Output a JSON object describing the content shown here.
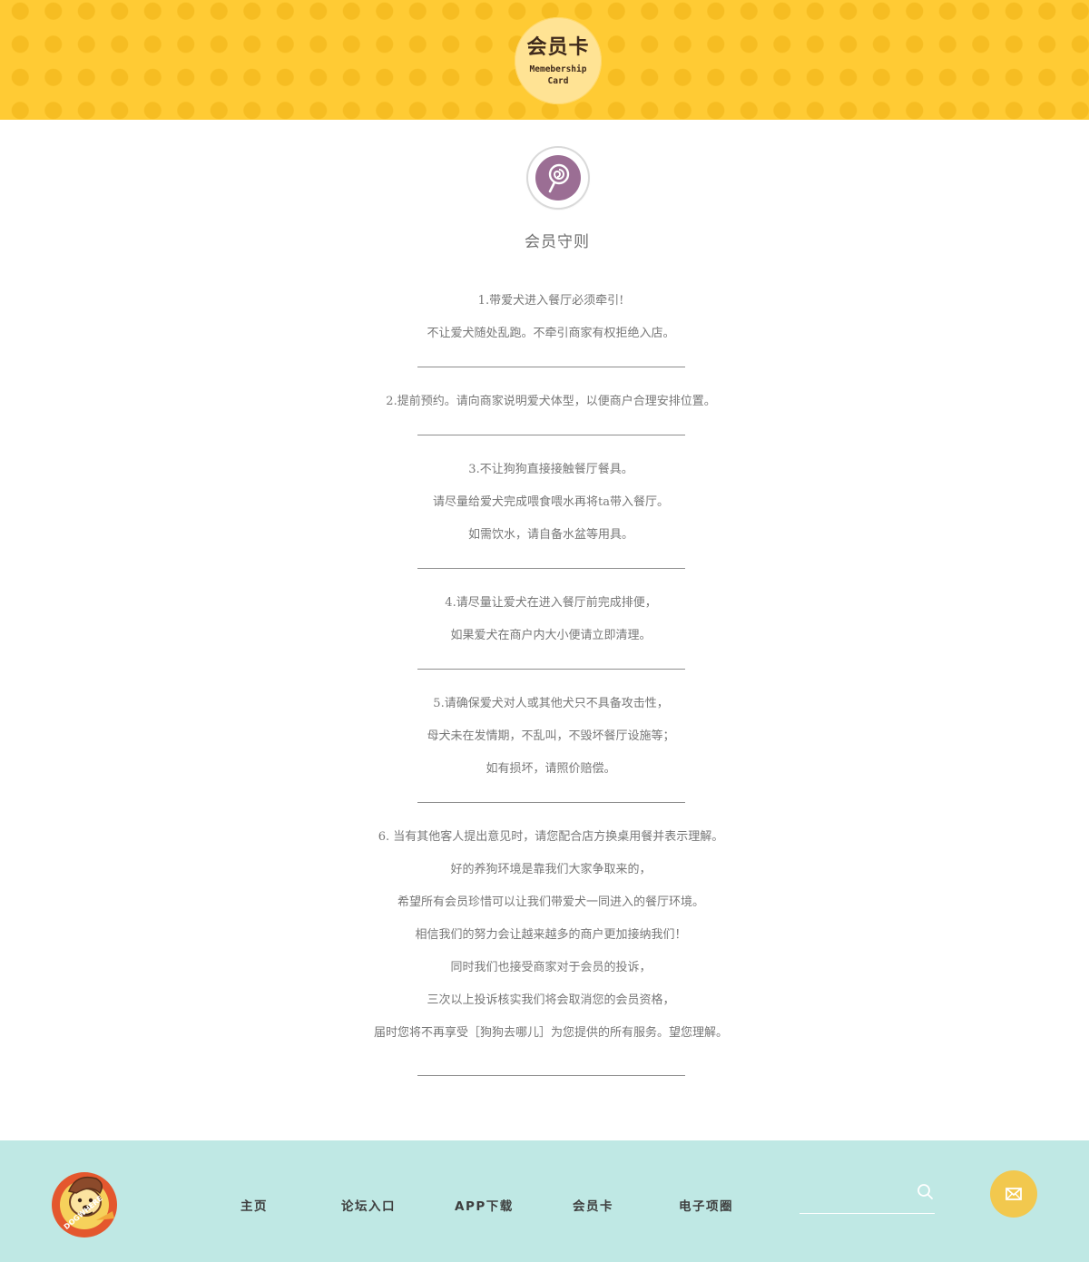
{
  "header": {
    "badge_title": "会员卡",
    "badge_sub_line1": "Memebership",
    "badge_sub_line2": "Card"
  },
  "section": {
    "icon": "lollipop-icon",
    "title": "会员守则"
  },
  "rules": [
    {
      "lines": [
        "1.带爱犬进入餐厅必须牵引!",
        "不让爱犬随处乱跑。不牵引商家有权拒绝入店。"
      ]
    },
    {
      "lines": [
        "2.提前预约。请向商家说明爱犬体型，以便商户合理安排位置。"
      ]
    },
    {
      "lines": [
        "3.不让狗狗直接接触餐厅餐具。",
        "请尽量给爱犬完成喂食喂水再将ta带入餐厅。",
        "如需饮水，请自备水盆等用具。"
      ]
    },
    {
      "lines": [
        "4.请尽量让爱犬在进入餐厅前完成排便，",
        "如果爱犬在商户内大小便请立即清理。"
      ]
    },
    {
      "lines": [
        "5.请确保爱犬对人或其他犬只不具备攻击性，",
        "母犬未在发情期，不乱叫，不毁坏餐厅设施等；",
        "如有损坏，请照价赔偿。"
      ]
    },
    {
      "lines": [
        "6. 当有其他客人提出意见时，请您配合店方换桌用餐并表示理解。",
        "好的养狗环境是靠我们大家争取来的，",
        "希望所有会员珍惜可以让我们带爱犬一同进入的餐厅环境。",
        "相信我们的努力会让越来越多的商户更加接纳我们！",
        "同时我们也接受商家对于会员的投诉，",
        "三次以上投诉核实我们将会取消您的会员资格，",
        "届时您将不再享受［狗狗去哪儿］为您提供的所有服务。望您理解。"
      ]
    }
  ],
  "footer": {
    "logo_text": "DOGWHERE",
    "nav": [
      "主页",
      "论坛入口",
      "APP下载",
      "会员卡",
      "电子项圈"
    ],
    "search_placeholder": "",
    "search_icon": "search-icon",
    "mail_icon": "mail-icon"
  },
  "colors": {
    "banner": "#ffcb34",
    "badge": "#ffe394",
    "icon_purple": "#9b6e94",
    "footer": "#bfe8e4",
    "mail_button": "#f2c84e"
  }
}
